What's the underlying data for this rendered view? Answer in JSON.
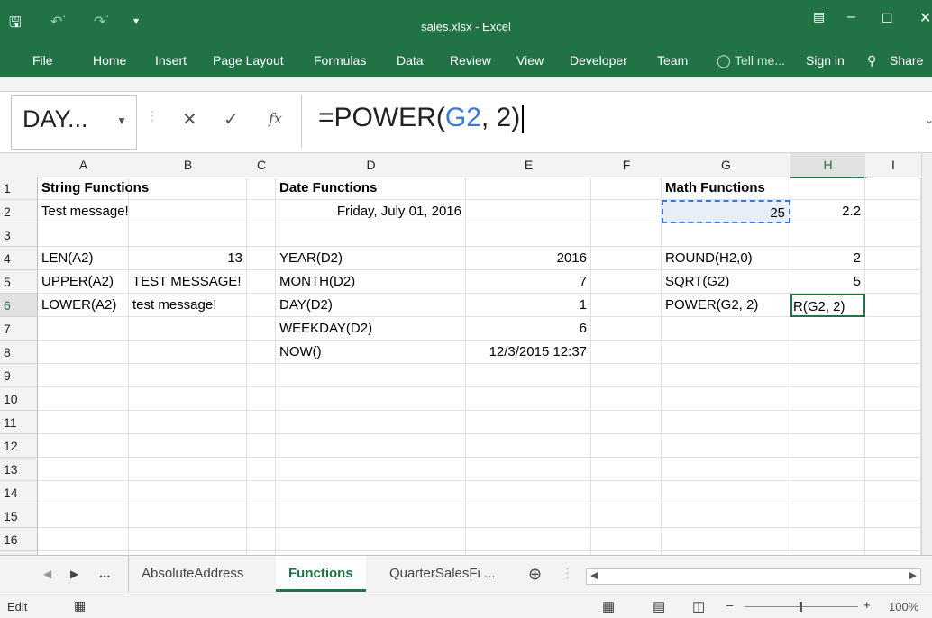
{
  "window": {
    "title": "sales.xlsx - Excel"
  },
  "ribbon": {
    "tabs": [
      "File",
      "Home",
      "Insert",
      "Page Layout",
      "Formulas",
      "Data",
      "Review",
      "View",
      "Developer",
      "Team"
    ],
    "tell_me": "Tell me...",
    "sign_in": "Sign in",
    "share": "Share"
  },
  "formula_bar": {
    "name_box": "DAY...",
    "formula_prefix": "=POWER(",
    "formula_ref": "G2",
    "formula_suffix": ", 2)"
  },
  "columns": [
    "A",
    "B",
    "C",
    "D",
    "E",
    "F",
    "G",
    "H",
    "I"
  ],
  "rows": [
    "1",
    "2",
    "3",
    "4",
    "5",
    "6",
    "7",
    "8",
    "9",
    "10",
    "11",
    "12",
    "13",
    "14",
    "15",
    "16",
    "17"
  ],
  "cells": {
    "A1": "String Functions",
    "D1": "Date Functions",
    "G1": "Math Functions",
    "A2": "Test message!",
    "D2": "Friday, July 01, 2016",
    "G2": "25",
    "H2": "2.2",
    "A4": "LEN(A2)",
    "B4": "13",
    "D4": "YEAR(D2)",
    "E4": "2016",
    "G4": "ROUND(H2,0)",
    "H4": "2",
    "A5": "UPPER(A2)",
    "B5": "TEST MESSAGE!",
    "D5": "MONTH(D2)",
    "E5": "7",
    "G5": "SQRT(G2)",
    "H5": "5",
    "A6": "LOWER(A2)",
    "B6": "test message!",
    "D6": "DAY(D2)",
    "E6": "1",
    "G6": "POWER(G2, 2)",
    "H6": "R(G2, 2)",
    "D7": "WEEKDAY(D2)",
    "E7": "6",
    "D8": "NOW()",
    "E8": "12/3/2015 12:37"
  },
  "sheet_tabs": {
    "ellipsis": "...",
    "tabs": [
      "AbsoluteAddress",
      "Functions",
      "QuarterSalesFi ..."
    ],
    "active": "Functions"
  },
  "status": {
    "mode": "Edit",
    "zoom": "100%"
  },
  "colors": {
    "excel_green": "#217346",
    "selection_blue": "#3c78d8"
  }
}
